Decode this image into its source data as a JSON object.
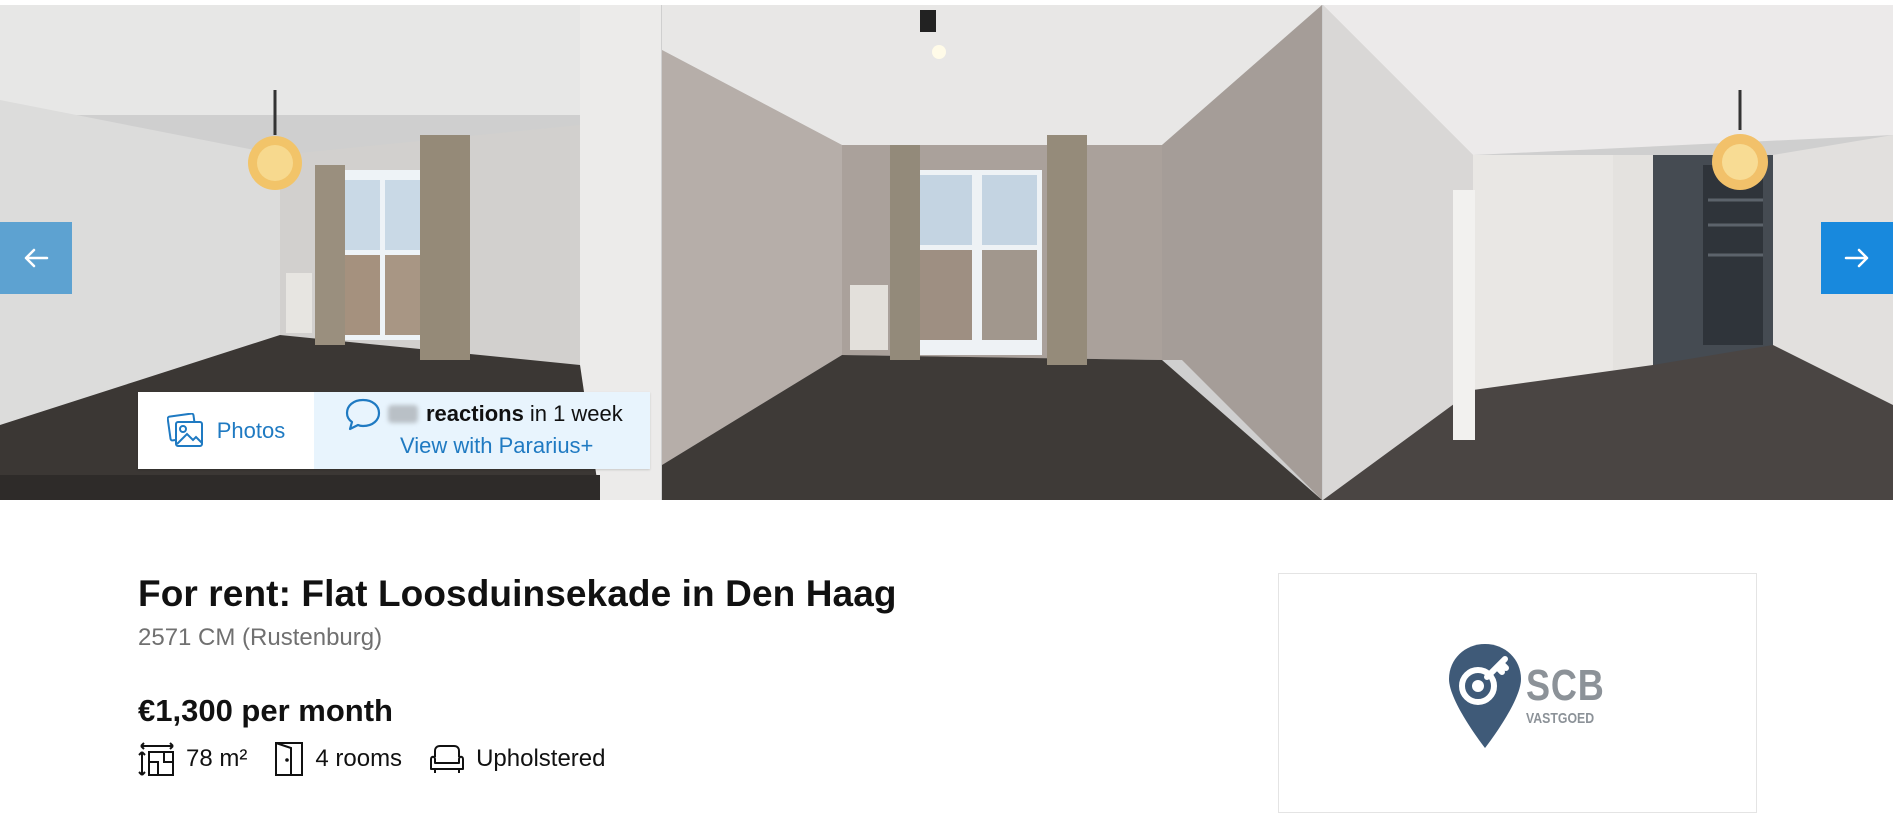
{
  "gallery": {
    "photo_alts": [
      "Living room with balcony doors",
      "Empty room with balcony doors",
      "Room with built-in wardrobe"
    ],
    "prev_icon": "arrow-left-icon",
    "next_icon": "arrow-right-icon"
  },
  "media": {
    "photos_label": "Photos",
    "photos_icon": "photos-icon",
    "reactions_bold": "reactions",
    "reactions_suffix": "in 1 week",
    "reactions_link": "View with Pararius+",
    "reactions_icon": "chat-bubble-icon"
  },
  "listing": {
    "title": "For rent: Flat Loosduinsekade in Den Haag",
    "subtitle": "2571 CM (Rustenburg)",
    "price": "€1,300 per month",
    "features": [
      {
        "icon": "surface-area-icon",
        "label": "78 m²"
      },
      {
        "icon": "rooms-door-icon",
        "label": "4 rooms"
      },
      {
        "icon": "sofa-icon",
        "label": "Upholstered"
      }
    ]
  },
  "agent": {
    "logo_text": "SCB",
    "logo_subtext": "VASTGOED",
    "brand_color": "#3f5a78"
  },
  "colors": {
    "accent": "#1889dd",
    "link": "#1f7ac2",
    "reactions_bg": "#e8f4fd"
  }
}
